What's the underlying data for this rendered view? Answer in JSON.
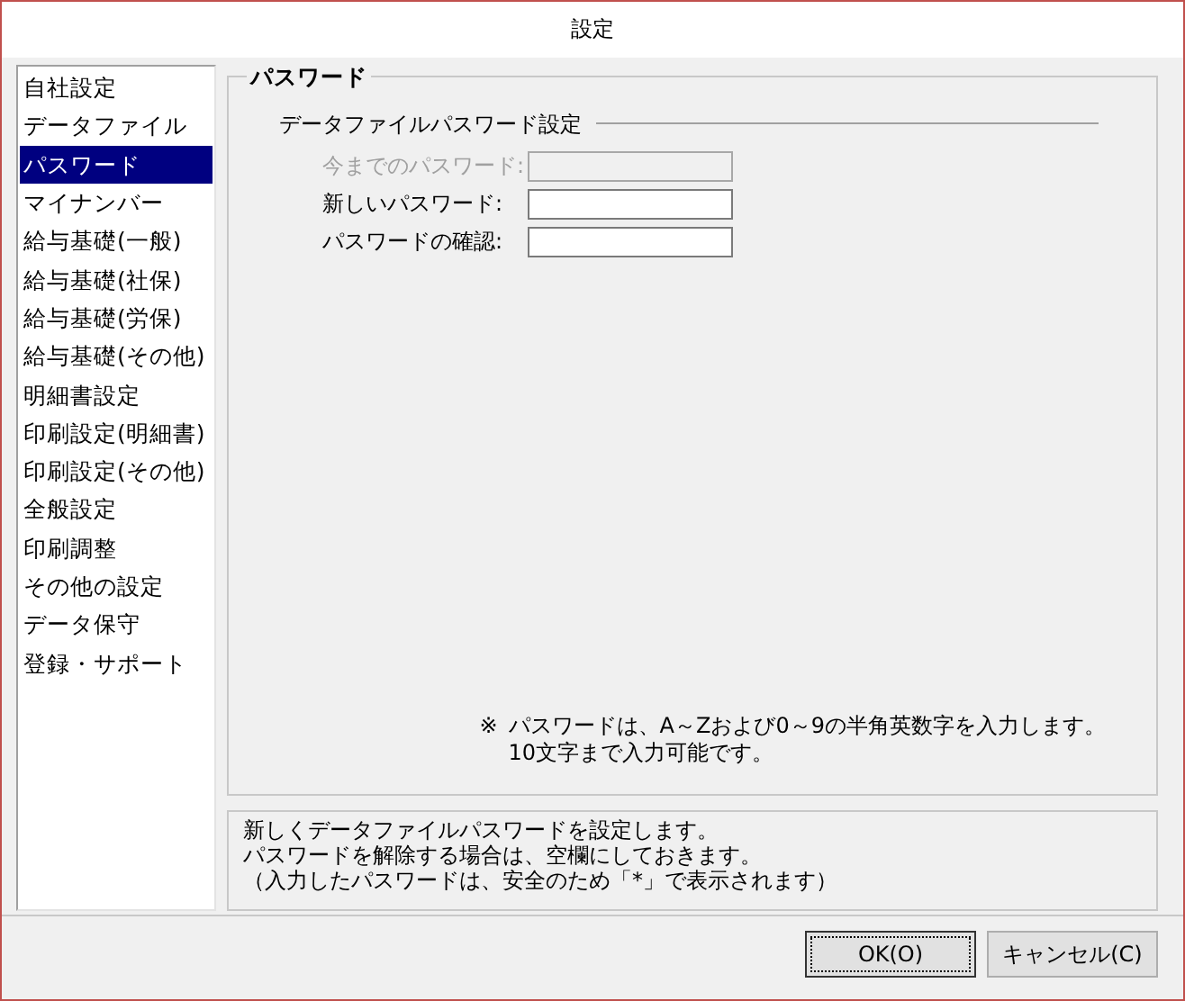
{
  "window": {
    "title": "設定"
  },
  "sidebar": {
    "items": [
      {
        "label": "自社設定",
        "selected": false
      },
      {
        "label": "データファイル",
        "selected": false
      },
      {
        "label": "パスワード",
        "selected": true
      },
      {
        "label": "マイナンバー",
        "selected": false
      },
      {
        "label": "給与基礎(一般)",
        "selected": false
      },
      {
        "label": "給与基礎(社保)",
        "selected": false
      },
      {
        "label": "給与基礎(労保)",
        "selected": false
      },
      {
        "label": "給与基礎(その他)",
        "selected": false
      },
      {
        "label": "明細書設定",
        "selected": false
      },
      {
        "label": "印刷設定(明細書)",
        "selected": false
      },
      {
        "label": "印刷設定(その他)",
        "selected": false
      },
      {
        "label": "全般設定",
        "selected": false
      },
      {
        "label": "印刷調整",
        "selected": false
      },
      {
        "label": "その他の設定",
        "selected": false
      },
      {
        "label": "データ保守",
        "selected": false
      },
      {
        "label": "登録・サポート",
        "selected": false
      }
    ]
  },
  "section": {
    "title": "パスワード",
    "subsection": "データファイルパスワード設定",
    "fields": [
      {
        "label": "今までのパスワード:",
        "disabled": true
      },
      {
        "label": "新しいパスワード:",
        "disabled": false
      },
      {
        "label": "パスワードの確認:",
        "disabled": false
      }
    ],
    "note": {
      "mark": "※",
      "lines": [
        "パスワードは、A～Zおよび0～9の半角英数字を入力します。",
        "10文字まで入力可能です。"
      ]
    }
  },
  "description": [
    "新しくデータファイルパスワードを設定します。",
    "パスワードを解除する場合は、空欄にしておきます。",
    "（入力したパスワードは、安全のため「*」で表示されます）"
  ],
  "buttons": [
    {
      "label": "OK(O)",
      "focused": true
    },
    {
      "label": "キャンセル(C)",
      "focused": false
    }
  ]
}
